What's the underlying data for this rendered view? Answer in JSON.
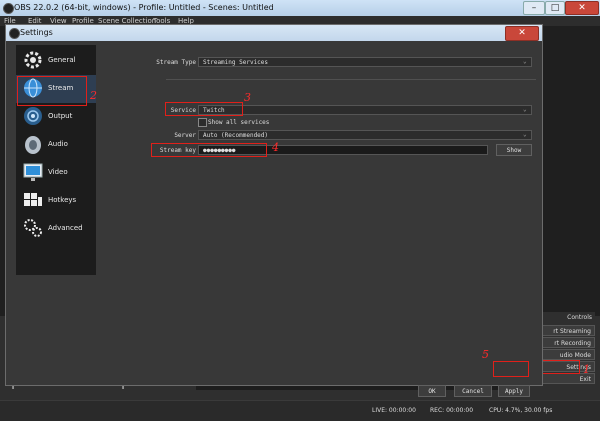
{
  "main_window": {
    "title": "OBS 22.0.2 (64-bit, windows) - Profile: Untitled - Scenes: Untitled",
    "menu": [
      "File",
      "Edit",
      "View",
      "Profile",
      "Scene Collection",
      "Tools",
      "Help"
    ],
    "controls": {
      "header": "Controls",
      "buttons": [
        "rt Streaming",
        "rt Recording",
        "udio Mode",
        "Settings",
        "Exit"
      ]
    },
    "toolbar": {
      "add": "+",
      "remove": "—",
      "up": "∧",
      "down": "∨",
      "gear": "✲"
    },
    "status": {
      "live": "LIVE: 00:00:00",
      "rec": "REC: 00:00:00",
      "cpu": "CPU: 4.7%, 30.00 fps"
    }
  },
  "settings": {
    "title": "Settings",
    "sidebar": [
      {
        "label": "General",
        "icon": "gear-icon"
      },
      {
        "label": "Stream",
        "icon": "globe-icon"
      },
      {
        "label": "Output",
        "icon": "output-icon"
      },
      {
        "label": "Audio",
        "icon": "speaker-icon"
      },
      {
        "label": "Video",
        "icon": "monitor-icon"
      },
      {
        "label": "Hotkeys",
        "icon": "keyboard-icon"
      },
      {
        "label": "Advanced",
        "icon": "gears-icon"
      }
    ],
    "stream_type": {
      "label": "Stream Type",
      "value": "Streaming Services"
    },
    "service": {
      "label": "Service",
      "value": "Twitch"
    },
    "show_all": {
      "label": "Show all services",
      "checked": false
    },
    "server": {
      "label": "Server",
      "value": "Auto (Recommended)"
    },
    "stream_key": {
      "label": "Stream key",
      "value": "●●●●●●●●●",
      "show_label": "Show"
    },
    "buttons": {
      "ok": "OK",
      "cancel": "Cancel",
      "apply": "Apply"
    }
  },
  "annotations": [
    "1",
    "2",
    "3",
    "4",
    "5"
  ],
  "colors": {
    "highlight": "#e0201a",
    "dialog_bg": "#383838",
    "sidebar_bg": "#1c1c1c"
  }
}
